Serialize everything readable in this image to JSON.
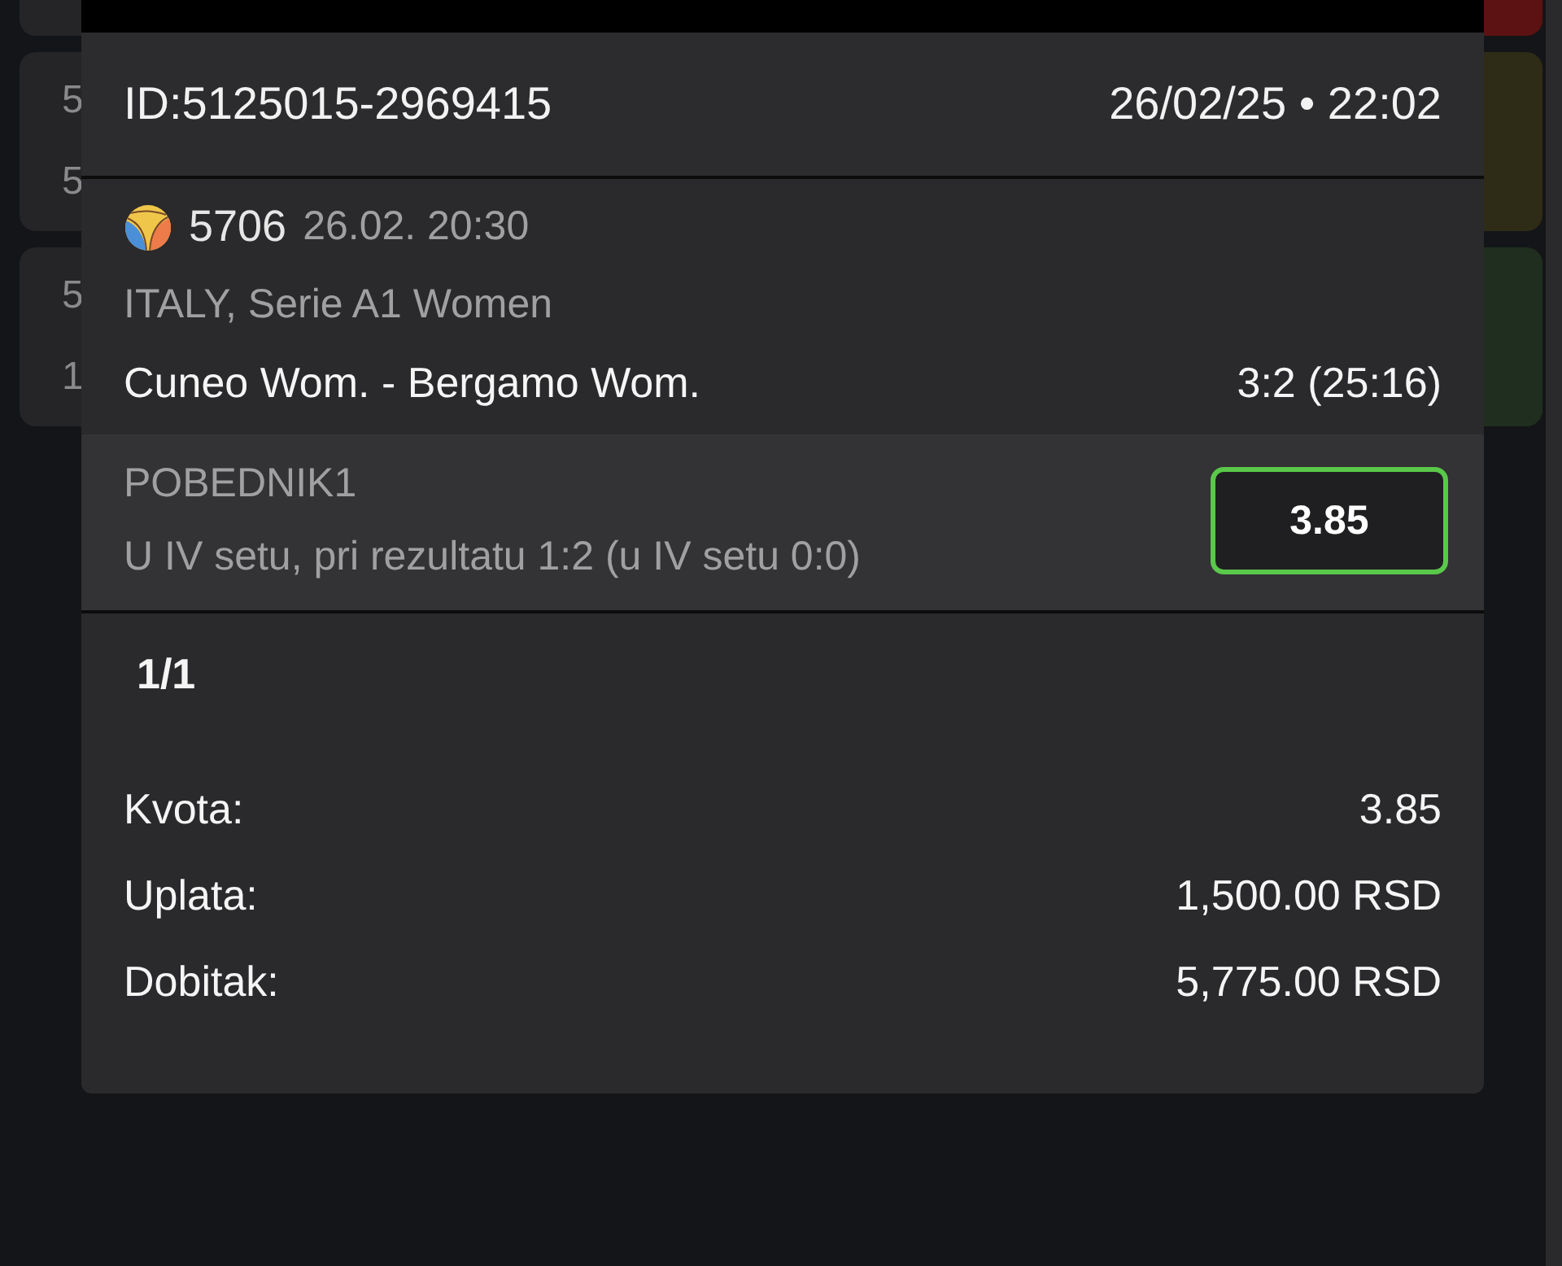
{
  "background_cards": [
    {
      "color": "#5c1212"
    },
    {
      "texts": [
        "5",
        "5"
      ],
      "color": "#2e2b17"
    },
    {
      "texts": [
        "5",
        "1"
      ],
      "color": "#1f2e1e"
    }
  ],
  "ticket": {
    "id": "ID:5125015-2969415",
    "datetime": "26/02/25 • 22:02",
    "event": {
      "code": "5706",
      "time": "26.02. 20:30",
      "league": "ITALY, Serie A1 Women",
      "match": "Cuneo Wom. - Bergamo Wom.",
      "score": "3:2 (25:16)"
    },
    "bet": {
      "market": "POBEDNIK1",
      "condition": "U IV setu, pri rezultatu 1:2 (u IV setu 0:0)",
      "odds": "3.85",
      "won": true
    },
    "combination": "1/1",
    "summary": [
      {
        "label": "Kvota:",
        "value": "3.85"
      },
      {
        "label": "Uplata:",
        "value": "1,500.00 RSD"
      },
      {
        "label": "Dobitak:",
        "value": "5,775.00 RSD"
      }
    ]
  }
}
